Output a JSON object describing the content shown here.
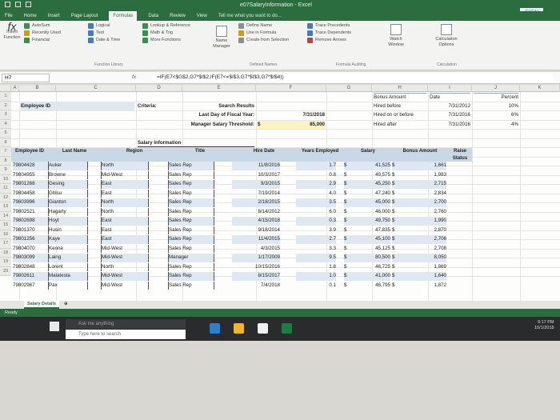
{
  "window": {
    "title": "e07SalaryInformation - Excel",
    "sign_in": "SIGN"
  },
  "ribbon": {
    "tabs": [
      "File",
      "Home",
      "Insert",
      "Page Layout",
      "Formulas",
      "Data",
      "Review",
      "View"
    ],
    "active_tab": "Formulas",
    "tell_me": "Tell me what you want to do...",
    "insert_function": "Insert Function",
    "library": {
      "col1": [
        "AutoSum",
        "Recently Used",
        "Financial"
      ],
      "col2": [
        "Logical",
        "Text",
        "Date & Time"
      ],
      "col3": [
        "Lookup & Reference",
        "Math & Trig",
        "More Functions"
      ],
      "label": "Function Library"
    },
    "names": {
      "manager": "Name Manager",
      "items": [
        "Define Name",
        "Use in Formula",
        "Create from Selection"
      ],
      "label": "Defined Names"
    },
    "auditing": {
      "items": [
        "Trace Precedents",
        "Trace Dependents",
        "Remove Arrows"
      ],
      "label": "Formula Auditing"
    },
    "watch": "Watch Window",
    "calc": {
      "options": "Calculation Options",
      "label": "Calculation"
    }
  },
  "formula_bar": {
    "name_box": "H7",
    "formula": "=IF(E7<$G$2,G7*$I$2,IF(E7<=$I$3,G7*$I$3,G7*$I$4))"
  },
  "columns": [
    "A",
    "B",
    "C",
    "D",
    "E",
    "F",
    "G",
    "H",
    "I",
    "J",
    "K"
  ],
  "rows": [
    "1",
    "2",
    "3",
    "4",
    "5",
    "6",
    "7",
    "8",
    "9",
    "10",
    "11",
    "12",
    "13",
    "14",
    "15",
    "16",
    "17",
    "18",
    "19",
    "20"
  ],
  "top": {
    "employee_id": "Employee ID",
    "criteria": "Criteria:",
    "search_results": "Search Results",
    "last_day": "Last Day of Fiscal Year:",
    "last_day_val": "7/31/2018",
    "threshold": "Manager Salary Threshold:",
    "threshold_cur": "$",
    "threshold_val": "85,000",
    "bonus_amount": "Bonus Amount",
    "date": "Date",
    "percent": "Percent",
    "bonus_rows": [
      {
        "label": "Hired before",
        "date": "7/31/2012",
        "pct": "10%"
      },
      {
        "label": "Hired on or before",
        "date": "7/31/2016",
        "pct": "6%"
      },
      {
        "label": "Hired after",
        "date": "7/31/2016",
        "pct": "4%"
      }
    ]
  },
  "table": {
    "section_title": "Salary Information",
    "headers": [
      "Employee ID",
      "Last Name",
      "Region",
      "Title",
      "Hire Date",
      "Years Employed",
      "Salary",
      "Bonus Amount",
      "Raise Status"
    ],
    "currency": "$",
    "rows": [
      [
        "79804428",
        "Auker",
        "North",
        "Sales Rep",
        "11/8/2016",
        "1.7",
        "41,525",
        "1,661"
      ],
      [
        "79804955",
        "Browne",
        "Mid-West",
        "Sales Rep",
        "10/3/2017",
        "0.8",
        "49,575",
        "1,983"
      ],
      [
        "79801268",
        "Gesing",
        "East",
        "Sales Rep",
        "9/3/2015",
        "2.9",
        "45,250",
        "2,715"
      ],
      [
        "79804458",
        "Ghlsu",
        "East",
        "Sales Rep",
        "7/19/2014",
        "4.0",
        "47,240",
        "2,834"
      ],
      [
        "79803996",
        "Gianton",
        "North",
        "Sales Rep",
        "2/18/2015",
        "3.5",
        "45,000",
        "2,700"
      ],
      [
        "79802521",
        "Hagarty",
        "North",
        "Sales Rep",
        "8/14/2012",
        "6.0",
        "46,000",
        "2,760"
      ],
      [
        "79802698",
        "Hoyt",
        "East",
        "Sales Rep",
        "4/15/2018",
        "0.3",
        "49,750",
        "1,990"
      ],
      [
        "79801370",
        "Husin",
        "East",
        "Sales Rep",
        "9/18/2014",
        "3.9",
        "47,835",
        "2,870"
      ],
      [
        "79801256",
        "Kaye",
        "East",
        "Sales Rep",
        "11/4/2015",
        "2.7",
        "45,100",
        "2,706"
      ],
      [
        "79804070",
        "Keone",
        "Mid-West",
        "Sales Rep",
        "4/3/2015",
        "3.3",
        "45,125",
        "2,708"
      ],
      [
        "79803099",
        "Laing",
        "Mid-West",
        "Manager",
        "1/17/2009",
        "9.5",
        "80,500",
        "8,050"
      ],
      [
        "79802848",
        "Lorent",
        "North",
        "Sales Rep",
        "10/15/2016",
        "1.8",
        "46,725",
        "1,869"
      ],
      [
        "79802611",
        "Malatesta",
        "Mid-West",
        "Sales Rep",
        "8/15/2017",
        "1.0",
        "41,000",
        "1,640"
      ],
      [
        "79802967",
        "Pax",
        "Mid-West",
        "Sales Rep",
        "7/4/2018",
        "0.1",
        "46,795",
        "1,872"
      ]
    ]
  },
  "sheet_tab": "Salary Details",
  "status": "Ready",
  "taskbar": {
    "cortana": "Ask me anything",
    "search": "Type here to search",
    "time": "9:17 PM",
    "date": "10/1/2018"
  }
}
